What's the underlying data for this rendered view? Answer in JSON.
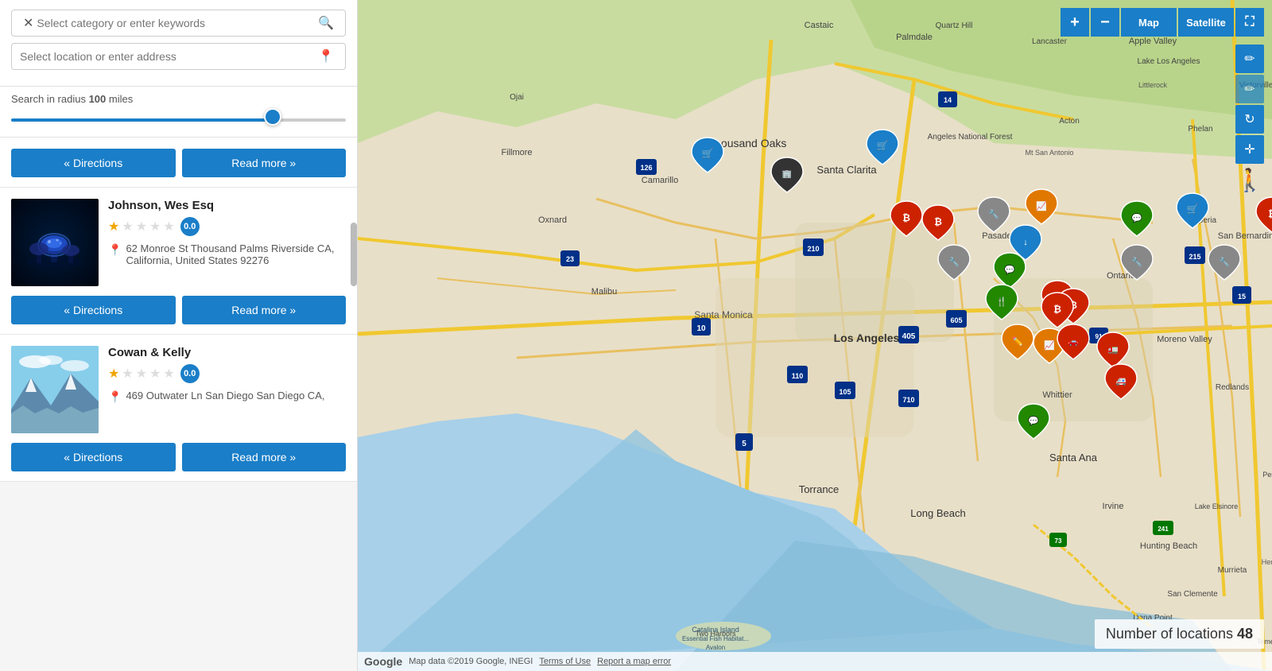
{
  "search": {
    "keyword_placeholder": "Select category or enter keywords",
    "location_placeholder": "Select location or enter address",
    "radius_label": "Search in radius",
    "radius_value": "100",
    "radius_unit": "miles"
  },
  "buttons": {
    "directions": "« Directions",
    "read_more": "Read more »",
    "map": "Map",
    "satellite": "Satellite"
  },
  "listings": [
    {
      "id": "first",
      "has_image": false,
      "name": "",
      "address": ""
    },
    {
      "id": "johnson",
      "has_image": true,
      "name": "Johnson, Wes Esq",
      "rating": 0.0,
      "address": "62 Monroe St Thousand Palms Riverside CA, California, United States 92276",
      "stars": [
        1,
        0,
        0,
        0,
        0
      ]
    },
    {
      "id": "cowan",
      "has_image": true,
      "name": "Cowan & Kelly",
      "rating": 0.0,
      "address": "469 Outwater Ln San Diego San Diego CA,",
      "stars": [
        1,
        0,
        0,
        0,
        0
      ]
    }
  ],
  "map": {
    "locations_count": "48",
    "locations_label": "Number of locations",
    "footer_text": "Map data ©2019 Google, INEGI",
    "terms_text": "Terms of Use",
    "report_text": "Report a map error",
    "google_logo": "Google"
  }
}
